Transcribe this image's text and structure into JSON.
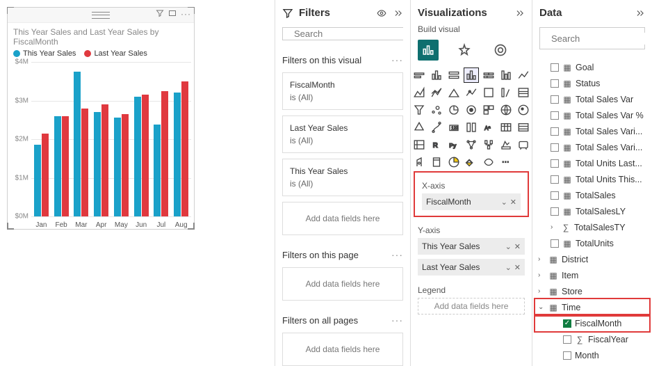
{
  "chart_data": {
    "type": "bar",
    "title": "This Year Sales and Last Year Sales by FiscalMonth",
    "xlabel": "",
    "ylabel": "",
    "ylim": [
      0,
      4000000
    ],
    "yticks": [
      "$0M",
      "$1M",
      "$2M",
      "$3M",
      "$4M"
    ],
    "categories": [
      "Jan",
      "Feb",
      "Mar",
      "Apr",
      "May",
      "Jun",
      "Jul",
      "Aug"
    ],
    "series": [
      {
        "name": "This Year Sales",
        "color": "#1aa1c9",
        "values": [
          1850000,
          2600000,
          3750000,
          2700000,
          2550000,
          3100000,
          2380000,
          3200000
        ]
      },
      {
        "name": "Last Year Sales",
        "color": "#e0393f",
        "values": [
          2150000,
          2600000,
          2800000,
          2900000,
          2650000,
          3150000,
          3250000,
          3500000
        ]
      }
    ]
  },
  "filters": {
    "title": "Filters",
    "search_placeholder": "Search",
    "sections": {
      "visual": "Filters on this visual",
      "page": "Filters on this page",
      "all": "Filters on all pages"
    },
    "visual_cards": [
      {
        "field": "FiscalMonth",
        "state": "is (All)"
      },
      {
        "field": "Last Year Sales",
        "state": "is (All)"
      },
      {
        "field": "This Year Sales",
        "state": "is (All)"
      }
    ],
    "placeholder": "Add data fields here"
  },
  "viz": {
    "title": "Visualizations",
    "subtitle": "Build visual",
    "wells": {
      "xaxis": {
        "label": "X-axis",
        "pill": "FiscalMonth"
      },
      "yaxis": {
        "label": "Y-axis",
        "pills": [
          "This Year Sales",
          "Last Year Sales"
        ]
      },
      "legend": {
        "label": "Legend",
        "placeholder": "Add data fields here"
      }
    }
  },
  "data": {
    "title": "Data",
    "search_placeholder": "Search",
    "fields_top": [
      "Goal",
      "Status",
      "Total Sales Var",
      "Total Sales Var %",
      "Total Sales Vari...",
      "Total Sales Vari...",
      "Total Units Last...",
      "Total Units This...",
      "TotalSales",
      "TotalSalesLY"
    ],
    "fields_measure": "TotalSalesTY",
    "fields_after": "TotalUnits",
    "tables": [
      "District",
      "Item",
      "Store"
    ],
    "time_table": "Time",
    "time_fields": {
      "checked": "FiscalMonth",
      "unchecked": [
        "FiscalYear",
        "Month"
      ]
    }
  }
}
